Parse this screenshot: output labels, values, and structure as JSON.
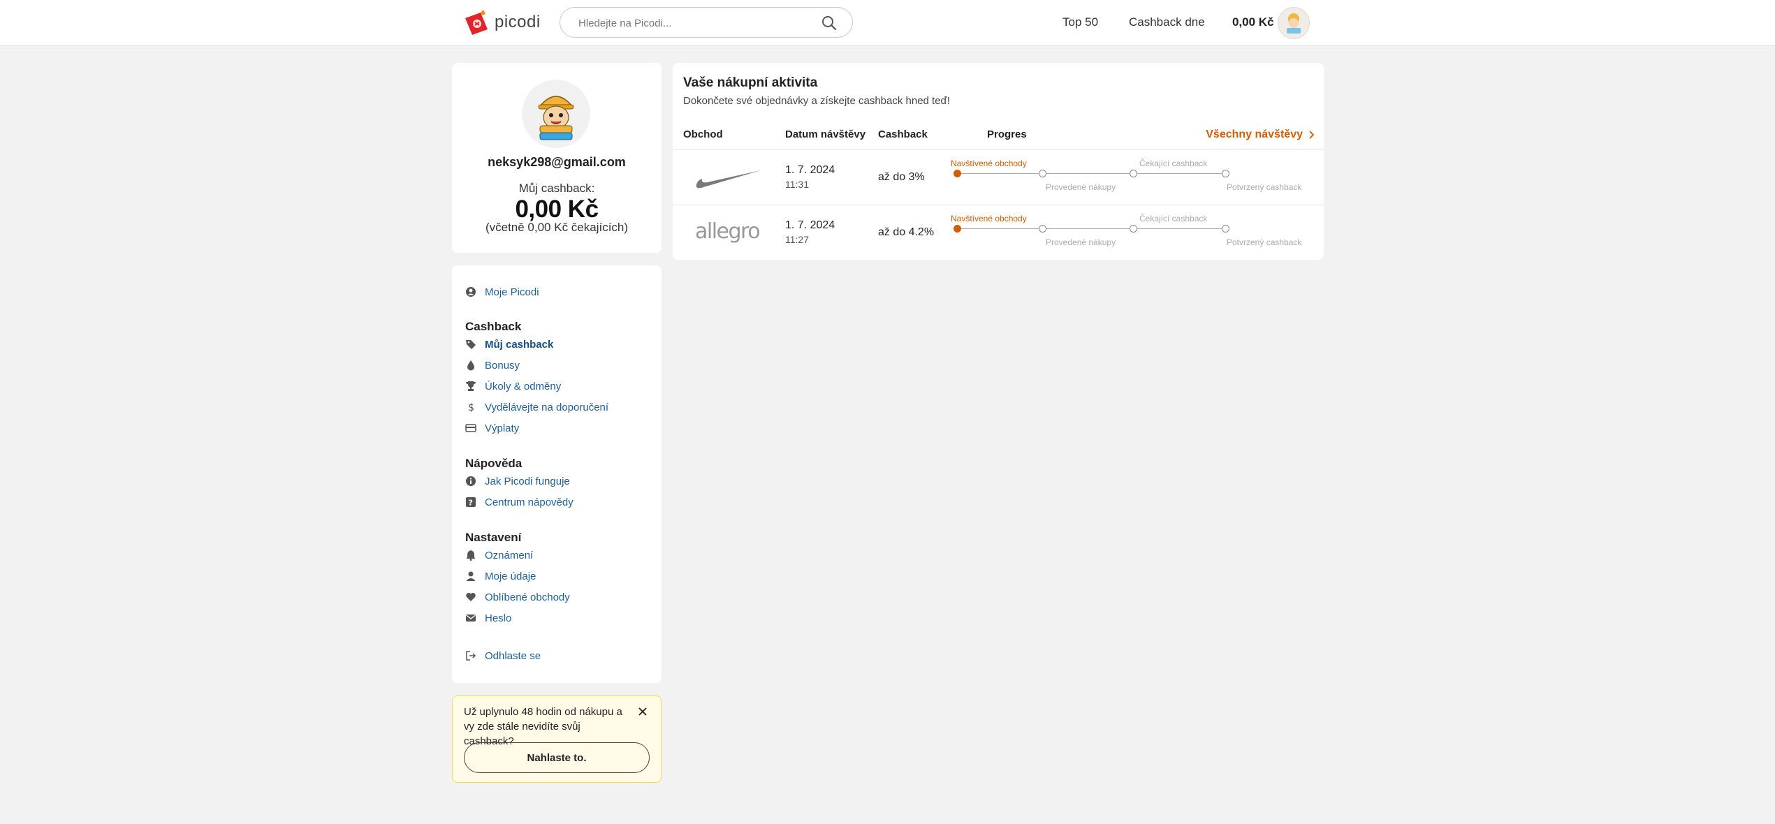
{
  "header": {
    "logo_text": "picodi",
    "search_placeholder": "Hledejte na Picodi...",
    "nav": [
      "Top 50",
      "Cashback dne"
    ],
    "balance": "0,00 Kč"
  },
  "profile": {
    "email": "neksyk298@gmail.com",
    "cashback_label": "Můj cashback:",
    "cashback_value": "0,00 Kč",
    "cashback_pending": "(včetně 0,00 Kč čekajících)",
    "avatar_text": "NEKSYK CZECH"
  },
  "menu": {
    "top_item": "Moje Picodi",
    "sections": [
      {
        "title": "Cashback",
        "items": [
          "Můj cashback",
          "Bonusy",
          "Úkoly & odměny",
          "Vydělávejte na doporučení",
          "Výplaty"
        ]
      },
      {
        "title": "Nápověda",
        "items": [
          "Jak Picodi funguje",
          "Centrum nápovědy"
        ]
      },
      {
        "title": "Nastavení",
        "items": [
          "Oznámení",
          "Moje údaje",
          "Oblíbené obchody",
          "Heslo"
        ]
      }
    ],
    "logout": "Odhlaste se",
    "active_item": "Můj cashback"
  },
  "notice": {
    "text": "Už uplynulo 48 hodin od nákupu a vy zde stále nevidíte svůj cashback?",
    "button": "Nahlaste to."
  },
  "activity": {
    "title": "Vaše nákupní aktivita",
    "subtitle": "Dokončete své objednávky a získejte cashback hned teď!",
    "columns": [
      "Obchod",
      "Datum návštěvy",
      "Cashback",
      "Progres"
    ],
    "all_visits": "Všechny návštěvy",
    "progress_steps": [
      "Navštívené obchody",
      "Provedené nákupy",
      "Čekající cashback",
      "Potvrzený cashback"
    ],
    "rows": [
      {
        "shop": "Nike",
        "date": "1. 7. 2024",
        "time": "11:31",
        "cashback": "až do 3%",
        "progress_step": 1
      },
      {
        "shop": "allegro",
        "date": "1. 7. 2024",
        "time": "11:27",
        "cashback": "až do 4.2%",
        "progress_step": 1
      }
    ]
  },
  "colors": {
    "accent": "#d15d00",
    "link": "#1d5f96",
    "notice_bg": "#fffbe6",
    "notice_border": "#f5d85c"
  }
}
